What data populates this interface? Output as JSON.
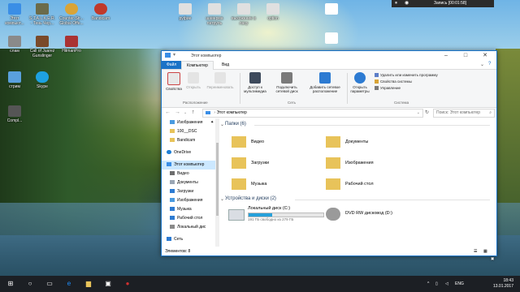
{
  "desktop": {
    "icons": [
      {
        "id": "this-pc",
        "label": "Этот компьют...",
        "color": "#3a8ee6"
      },
      {
        "id": "stalker",
        "label": "S.T.A.L.K.E.R. - Тень Чер...",
        "color": "#6b6b4a"
      },
      {
        "id": "csgo",
        "label": "Counter-Str... Global Offe...",
        "color": "#d9a437"
      },
      {
        "id": "bandicam1",
        "label": "Bandicam",
        "color": "#c0392b"
      },
      {
        "id": "slam",
        "label": "слам",
        "color": "#8a8a8a"
      },
      {
        "id": "call-of-juarez",
        "label": "Call of Juarez Gunslinger",
        "color": "#7a4a2a"
      },
      {
        "id": "hitmanpro",
        "label": "HitmanPro",
        "color": "#aa3333"
      },
      {
        "id": "recycle",
        "label": "стрим",
        "color": "#5aa0dd"
      },
      {
        "id": "skype",
        "label": "Skype",
        "color": "#1ea1e1"
      },
      {
        "id": "comp2",
        "label": "Compl...",
        "color": "#555555"
      },
      {
        "id": "rufus",
        "label": "руфие",
        "color": "#e0e0e0"
      },
      {
        "id": "shaverma",
        "label": "шаверма патруль",
        "color": "#e0e0e0"
      },
      {
        "id": "vykhod",
        "label": "выхожение в ласу",
        "color": "#e0e0e0"
      },
      {
        "id": "option",
        "label": "option",
        "color": "#e0e0e0"
      },
      {
        "id": "doc1",
        "label": "",
        "color": "#ffffff"
      },
      {
        "id": "doc2",
        "label": "",
        "color": "#ffffff"
      }
    ]
  },
  "recording": {
    "text": "Запись [00:01:58]"
  },
  "window": {
    "title": "Этот компьютер",
    "menu": [
      "Файл",
      "Компьютер",
      "Вид"
    ],
    "ribbon": {
      "location": {
        "group": "Расположение",
        "buttons": [
          "Свойства",
          "Открыть",
          "Переименовать"
        ]
      },
      "network": {
        "group": "Сеть",
        "buttons": [
          "Доступ к мультимедиа",
          "Подключить сетевой диск",
          "Добавить сетевое расположение"
        ]
      },
      "system": {
        "group": "Система",
        "open_params": "Открыть параметры",
        "items": [
          "Удалить или изменить программу",
          "Свойства системы",
          "Управление"
        ]
      }
    },
    "address": "Этот компьютер",
    "search_placeholder": "Поиск: Этот компьютер",
    "nav": [
      {
        "label": "Изображения",
        "icon": "pictures-icon",
        "pinned": "true"
      },
      {
        "label": "100__DSC",
        "icon": "folder-icon"
      },
      {
        "label": "Bandicam",
        "icon": "folder-icon"
      },
      {
        "label": "OneDrive",
        "icon": "onedrive-icon"
      },
      {
        "label": "Этот компьютер",
        "icon": "computer-icon",
        "selected": "true"
      },
      {
        "label": "Видео",
        "icon": "video-icon"
      },
      {
        "label": "Документы",
        "icon": "documents-icon"
      },
      {
        "label": "Загрузки",
        "icon": "downloads-icon"
      },
      {
        "label": "Изображения",
        "icon": "pictures-icon"
      },
      {
        "label": "Музыка",
        "icon": "music-icon"
      },
      {
        "label": "Рабочий стол",
        "icon": "desktop-icon"
      },
      {
        "label": "Локальный дис",
        "icon": "drive-icon"
      },
      {
        "label": "Сеть",
        "icon": "network-icon"
      }
    ],
    "folders_header": "Папки (6)",
    "folders": [
      {
        "label": "Видео",
        "icon": "video-folder-icon"
      },
      {
        "label": "Документы",
        "icon": "documents-folder-icon"
      },
      {
        "label": "Загрузки",
        "icon": "downloads-folder-icon"
      },
      {
        "label": "Изображения",
        "icon": "pictures-folder-icon"
      },
      {
        "label": "Музыка",
        "icon": "music-folder-icon"
      },
      {
        "label": "Рабочий стол",
        "icon": "desktop-folder-icon"
      }
    ],
    "drives_header": "Устройства и диски (2)",
    "drives": [
      {
        "name": "Локальный диск (C:)",
        "free": "191 ГБ свободно из 279 ГБ",
        "used_fraction": 0.32
      },
      {
        "name": "DVD RW дисковод (D:)"
      }
    ],
    "status": "Элементов: 8"
  },
  "taskbar": {
    "start": "windows-start-icon",
    "tray_lang": "ENG",
    "time": "18:43",
    "date": "13.01.2017"
  },
  "colors": {
    "accent": "#1a73c7",
    "ribbon_bg": "#f5f6f7",
    "selection": "#cce8ff",
    "drive_fill": "#26a0da",
    "taskbar": "#1c1f24"
  }
}
